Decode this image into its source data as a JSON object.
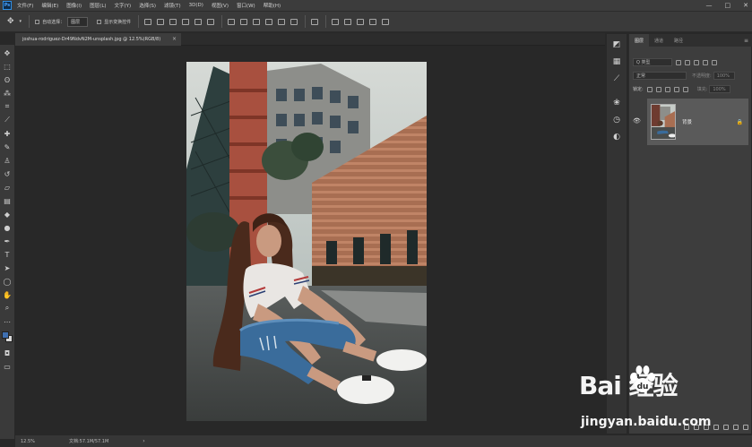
{
  "menubar": {
    "logo": "Ps",
    "items": [
      "文件(F)",
      "编辑(E)",
      "图像(I)",
      "图层(L)",
      "文字(Y)",
      "选择(S)",
      "滤镜(T)",
      "3D(D)",
      "视图(V)",
      "窗口(W)",
      "帮助(H)"
    ],
    "window_controls": {
      "minimize": "—",
      "maximize": "□",
      "close": "✕"
    }
  },
  "optbar": {
    "auto_select_label": "自动选择：",
    "auto_select_value": "图层",
    "transform_label": "显示变换控件"
  },
  "document": {
    "tab_title": "joshua-rodriguez-Dr49NdvN2M-unsplash.jpg @ 12.5%(RGB/8)",
    "tab_close": "×"
  },
  "statusbar": {
    "zoom": "12.5%",
    "doc_info": "文档:57.1M/57.1M",
    "arrow": "›"
  },
  "layers_panel": {
    "tabs": [
      "图层",
      "通道",
      "路径"
    ],
    "menu_icon": "≡",
    "filter_kind": "Q 类型",
    "blend_mode": "正常",
    "opacity_label": "不透明度:",
    "opacity_value": "100%",
    "lock_label": "锁定:",
    "fill_label": "填充:",
    "fill_value": "100%",
    "layer_name": "背景",
    "lock_icon": "🔒",
    "eye_icon": "👁"
  },
  "watermark": {
    "logo_text": "Bai  经验",
    "url": "jingyan.baidu.com"
  },
  "colors": {
    "accent": "#2f8fe6",
    "foreground_swatch": "#3f6fb0",
    "background_swatch": "#d8d8d8"
  }
}
